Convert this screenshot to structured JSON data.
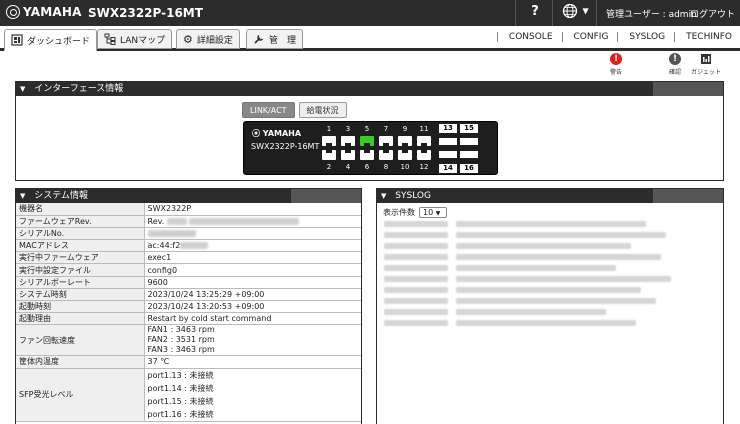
{
  "header": {
    "brand": "YAMAHA",
    "model": "SWX2322P-16MT",
    "help": "?",
    "language_icon": "globe-icon",
    "user_label": "管理ユーザー : admin",
    "logout": "ログアウト"
  },
  "tabs": [
    {
      "label": "ダッシュボード",
      "icon": "dashboard-icon",
      "active": true
    },
    {
      "label": "LANマップ",
      "icon": "lan-map-icon",
      "active": false
    },
    {
      "label": "詳細設定",
      "icon": "gear-icon",
      "active": false
    },
    {
      "label": "管　理",
      "icon": "wrench-icon",
      "active": false
    }
  ],
  "sublinks": [
    "CONSOLE",
    "CONFIG",
    "SYSLOG",
    "TECHINFO"
  ],
  "status_icons": [
    {
      "label": "警告",
      "icon": "warning-icon",
      "color": "#e0201c"
    },
    {
      "label": "確認",
      "icon": "info-icon",
      "color": "#555555"
    },
    {
      "label": "ガジェット",
      "icon": "gadget-icon",
      "color": "#333333"
    }
  ],
  "interface_panel": {
    "title": "インターフェース情報",
    "buttons": [
      "LINK/ACT",
      "給電状況"
    ],
    "switch_brand": "YAMAHA",
    "switch_model": "SWX2322P-16MT",
    "ports_top": [
      "1",
      "3",
      "5",
      "7",
      "9",
      "11"
    ],
    "ports_bottom": [
      "2",
      "4",
      "6",
      "8",
      "10",
      "12"
    ],
    "sfp_top": [
      "13",
      "15"
    ],
    "sfp_bottom": [
      "14",
      "16"
    ],
    "lit_port": "5"
  },
  "system_panel": {
    "title": "システム情報",
    "rows": [
      {
        "key": "機器名",
        "value": "SWX2322P"
      },
      {
        "key": "ファームウェアRev.",
        "value": "Rev."
      },
      {
        "key": "シリアルNo.",
        "value": ""
      },
      {
        "key": "MACアドレス",
        "value": "ac:44:f2"
      },
      {
        "key": "実行中ファームウェア",
        "value": "exec1"
      },
      {
        "key": "実行中設定ファイル",
        "value": "config0"
      },
      {
        "key": "シリアルボーレート",
        "value": "9600"
      },
      {
        "key": "システム時刻",
        "value": "2023/10/24 13:25:29 +09:00"
      },
      {
        "key": "起動時刻",
        "value": "2023/10/24 13:20:53 +09:00"
      },
      {
        "key": "起動理由",
        "value": "Restart by cold start command"
      }
    ],
    "fan_key": "ファン回転速度",
    "fans": [
      "FAN1 : 3463 rpm",
      "FAN2 : 3531 rpm",
      "FAN3 : 3463 rpm"
    ],
    "temp_key": "筐体内温度",
    "temp_value": "37 ℃",
    "sfp_key": "SFP受光レベル",
    "sfp_values": [
      "port1.13 : 未接続",
      "port1.14 : 未接続",
      "port1.15 : 未接続",
      "port1.16 : 未接続"
    ]
  },
  "syslog_panel": {
    "title": "SYSLOG",
    "count_label": "表示件数",
    "count_value": "10"
  },
  "colors": {
    "header_bg": "#2c2c2c",
    "port_active": "#3dc92c",
    "warning": "#e0201c"
  }
}
